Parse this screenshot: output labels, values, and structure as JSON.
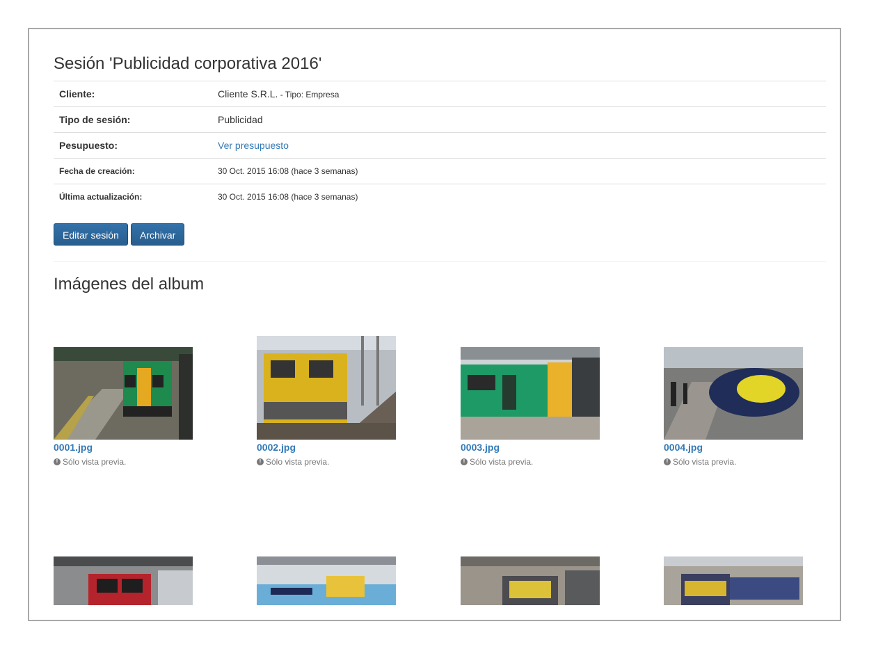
{
  "session": {
    "title": "Sesión 'Publicidad corporativa 2016'",
    "rows": [
      {
        "key": "Cliente:",
        "value": "Cliente S.R.L.",
        "extra": " - Tipo: Empresa"
      },
      {
        "key": "Tipo de sesión:",
        "value": "Publicidad"
      },
      {
        "key": "Pesupuesto:",
        "value": "Ver presupuesto"
      },
      {
        "key": "Fecha de creación:",
        "value": "30 Oct. 2015 16:08 (hace 3 semanas)"
      },
      {
        "key": "Última actualización:",
        "value": "30 Oct. 2015 16:08 (hace 3 semanas)"
      }
    ]
  },
  "actions": {
    "edit_label": "Editar sesión",
    "archive_label": "Archivar"
  },
  "album": {
    "title": "Imágenes del album",
    "preview_note": "Sólo vista previa.",
    "images": [
      {
        "name": "0001.jpg"
      },
      {
        "name": "0002.jpg"
      },
      {
        "name": "0003.jpg"
      },
      {
        "name": "0004.jpg"
      },
      {
        "name": ""
      },
      {
        "name": ""
      },
      {
        "name": ""
      },
      {
        "name": ""
      }
    ]
  },
  "colors": {
    "primary": "#2e6da4",
    "link": "#337ab7",
    "muted": "#777777",
    "border": "#a9a9a9"
  }
}
